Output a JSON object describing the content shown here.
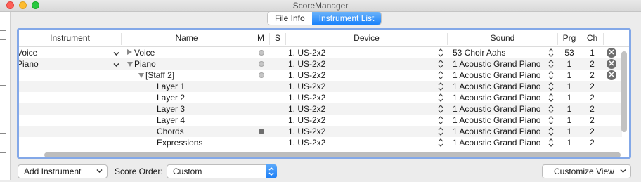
{
  "window": {
    "title": "ScoreManager"
  },
  "tabs": [
    {
      "label": "File Info",
      "active": false
    },
    {
      "label": "Instrument List",
      "active": true
    }
  ],
  "table": {
    "headers": [
      "Instrument",
      "Name",
      "M",
      "S",
      "Device",
      "Sound",
      "Prg",
      "Ch"
    ],
    "rows": [
      {
        "instrument": "Voice",
        "name": "Voice",
        "expander": "collapsed",
        "mute": "light",
        "device": "1. US-2x2",
        "sound": "53 Choir Aahs",
        "prg": "53",
        "ch": "1",
        "delete": true
      },
      {
        "instrument": "Piano",
        "name": "Piano",
        "expander": "expanded",
        "mute": "light",
        "device": "1. US-2x2",
        "sound": "1 Acoustic Grand Piano",
        "prg": "1",
        "ch": "2",
        "delete": true
      },
      {
        "instrument": "",
        "name": "[Staff 2]",
        "expander": "expanded",
        "mute": "light",
        "device": "1. US-2x2",
        "sound": "1 Acoustic Grand Piano",
        "prg": "1",
        "ch": "2",
        "delete": true
      },
      {
        "instrument": "",
        "name": "Layer 1",
        "expander": "",
        "mute": "",
        "device": "1. US-2x2",
        "sound": "1 Acoustic Grand Piano",
        "prg": "1",
        "ch": "2",
        "delete": false
      },
      {
        "instrument": "",
        "name": "Layer 2",
        "expander": "",
        "mute": "",
        "device": "1. US-2x2",
        "sound": "1 Acoustic Grand Piano",
        "prg": "1",
        "ch": "2",
        "delete": false
      },
      {
        "instrument": "",
        "name": "Layer 3",
        "expander": "",
        "mute": "",
        "device": "1. US-2x2",
        "sound": "1 Acoustic Grand Piano",
        "prg": "1",
        "ch": "2",
        "delete": false
      },
      {
        "instrument": "",
        "name": "Layer 4",
        "expander": "",
        "mute": "",
        "device": "1. US-2x2",
        "sound": "1 Acoustic Grand Piano",
        "prg": "1",
        "ch": "2",
        "delete": false
      },
      {
        "instrument": "",
        "name": "Chords",
        "expander": "",
        "mute": "dark",
        "device": "1. US-2x2",
        "sound": "1 Acoustic Grand Piano",
        "prg": "1",
        "ch": "2",
        "delete": false
      },
      {
        "instrument": "",
        "name": "Expressions",
        "expander": "",
        "mute": "",
        "device": "1. US-2x2",
        "sound": "1 Acoustic Grand Piano",
        "prg": "1",
        "ch": "2",
        "delete": false
      }
    ]
  },
  "footer": {
    "add_instrument_label": "Add Instrument",
    "score_order_label": "Score Order:",
    "score_order_value": "Custom",
    "customize_view_label": "Customize View"
  },
  "colors": {
    "accent": "#1a82fb",
    "focus_ring": "#83a8e8"
  },
  "icons": {
    "delete": "x-circle-icon",
    "mute": "mute-dot-icon",
    "popup": "chevron-down-icon",
    "stepper": "up-down-stepper-icon"
  }
}
